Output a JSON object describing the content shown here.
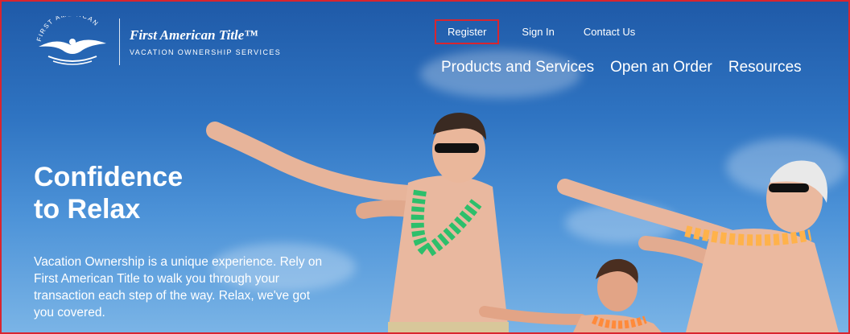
{
  "brand": {
    "seal_text": "FIRST AMERICAN",
    "name": "First American Title™",
    "tagline": "VACATION OWNERSHIP SERVICES"
  },
  "utility_nav": [
    {
      "label": "Register"
    },
    {
      "label": "Sign In"
    },
    {
      "label": "Contact Us"
    }
  ],
  "main_nav": [
    {
      "label": "Products and Services"
    },
    {
      "label": "Open an Order"
    },
    {
      "label": "Resources"
    }
  ],
  "hero": {
    "title_line1": "Confidence",
    "title_line2": "to Relax",
    "body": "Vacation Ownership is a unique experience. Rely on First American Title to walk you through your transaction each step of the way. Relax, we've got you covered."
  },
  "colors": {
    "highlight_border": "#d9252f",
    "sky": "#2f74c2"
  }
}
